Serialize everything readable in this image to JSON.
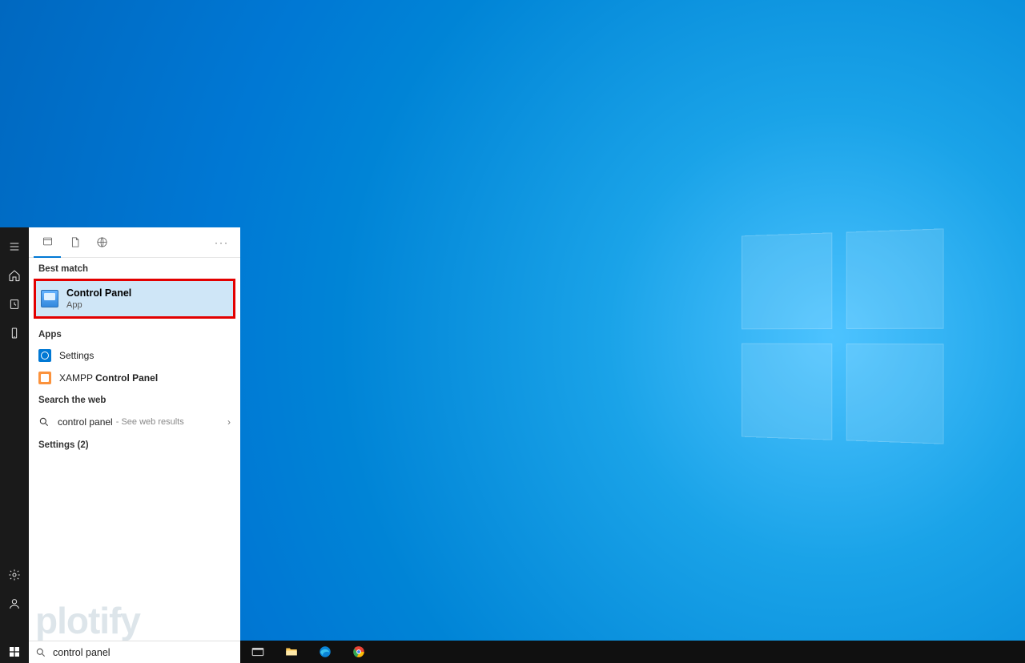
{
  "watermark": "plotify",
  "rail": {
    "menu": "menu-icon",
    "home": "home-icon",
    "clock": "history-icon",
    "device": "device-icon",
    "settings": "settings-icon",
    "account": "account-icon"
  },
  "panel": {
    "best_match_label": "Best match",
    "best_match": {
      "title": "Control Panel",
      "subtitle": "App"
    },
    "apps_label": "Apps",
    "apps": [
      {
        "icon": "settings",
        "label_plain": "Settings",
        "label_bold": ""
      },
      {
        "icon": "xampp",
        "label_plain": "XAMPP ",
        "label_bold": "Control Panel"
      }
    ],
    "web_label": "Search the web",
    "web": {
      "query": "control panel",
      "hint": "See web results"
    },
    "settings_group": "Settings (2)"
  },
  "search": {
    "value": "control panel"
  },
  "taskbar": {
    "items": [
      "task-view-icon",
      "file-explorer-icon",
      "edge-icon",
      "chrome-icon"
    ]
  }
}
